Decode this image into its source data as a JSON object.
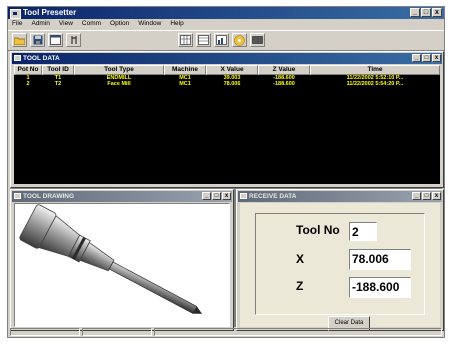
{
  "app": {
    "title": "Tool Presetter"
  },
  "menu": [
    "File",
    "Admin",
    "View",
    "Comm",
    "Option",
    "Window",
    "Help"
  ],
  "window_buttons": {
    "minimize": "_",
    "maximize": "□",
    "close": "x"
  },
  "toolbar_icons": [
    "open-folder-icon",
    "save-disk-icon",
    "new-window-icon",
    "tool-icon",
    "grid-view-icon",
    "table-view-icon",
    "chart-view-icon",
    "cd-icon",
    "layout-icon"
  ],
  "tool_data": {
    "title": "TOOL DATA",
    "columns": [
      "Pot No",
      "Tool ID",
      "Tool Type",
      "Machine",
      "X Value",
      "Z Value",
      "Time"
    ],
    "rows": [
      [
        "1",
        "T1",
        "ENDMILL",
        "MC1",
        "39.003",
        "-188.600",
        "11/22/2002 5:52:10 P..."
      ],
      [
        "2",
        "T2",
        "Face Mill",
        "MC1",
        "78.006",
        "-188.600",
        "11/22/2002 5:54:20 P..."
      ]
    ]
  },
  "tool_drawing": {
    "title": "TOOL DRAWING"
  },
  "receive_data": {
    "title": "RECEIVE DATA",
    "tool_no_label": "Tool No",
    "tool_no_value": "2",
    "x_label": "X",
    "x_value": "78.006",
    "z_label": "Z",
    "z_value": "-188.600",
    "clear_button": "Clear Data"
  }
}
